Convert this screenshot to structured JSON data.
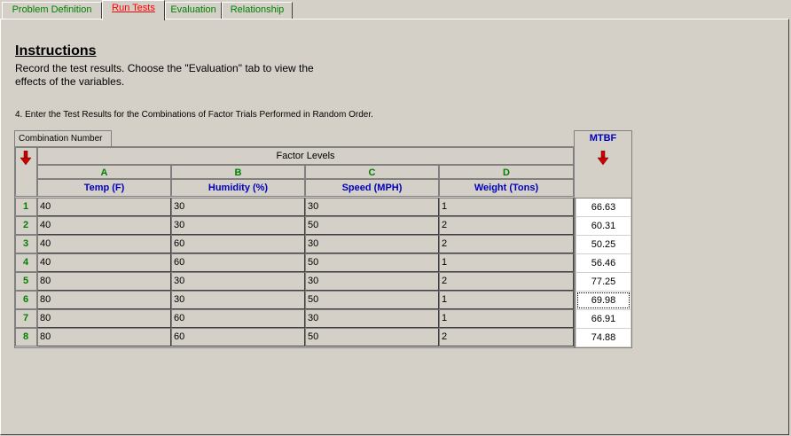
{
  "tabs": [
    {
      "label": "Problem Definition",
      "active": false
    },
    {
      "label": "Run Tests",
      "active": true
    },
    {
      "label": "Evaluation",
      "active": false
    },
    {
      "label": "Relationship",
      "active": false
    }
  ],
  "instructions": {
    "title": "Instructions",
    "text": "Record the test results. Choose the \"Evaluation\" tab to view the effects of the variables."
  },
  "step_text": "4. Enter the Test Results for the Combinations of Factor Trials Performed in Random Order.",
  "grid": {
    "combination_label": "Combination Number",
    "factor_levels_label": "Factor Levels",
    "mtbf_label": "MTBF",
    "factors": [
      {
        "letter": "A",
        "name": "Temp (F)"
      },
      {
        "letter": "B",
        "name": "Humidity (%)"
      },
      {
        "letter": "C",
        "name": "Speed (MPH)"
      },
      {
        "letter": "D",
        "name": "Weight (Tons)"
      }
    ],
    "rows": [
      {
        "n": "1",
        "a": "40",
        "b": "30",
        "c": "30",
        "d": "1",
        "mtbf": "66.63"
      },
      {
        "n": "2",
        "a": "40",
        "b": "30",
        "c": "50",
        "d": "2",
        "mtbf": "60.31"
      },
      {
        "n": "3",
        "a": "40",
        "b": "60",
        "c": "30",
        "d": "2",
        "mtbf": "50.25"
      },
      {
        "n": "4",
        "a": "40",
        "b": "60",
        "c": "50",
        "d": "1",
        "mtbf": "56.46"
      },
      {
        "n": "5",
        "a": "80",
        "b": "30",
        "c": "30",
        "d": "2",
        "mtbf": "77.25"
      },
      {
        "n": "6",
        "a": "80",
        "b": "30",
        "c": "50",
        "d": "1",
        "mtbf": "69.98"
      },
      {
        "n": "7",
        "a": "80",
        "b": "60",
        "c": "30",
        "d": "1",
        "mtbf": "66.91"
      },
      {
        "n": "8",
        "a": "80",
        "b": "60",
        "c": "50",
        "d": "2",
        "mtbf": "74.88"
      }
    ]
  },
  "colors": {
    "accent_green": "#008000",
    "header_blue": "#0000c0",
    "arrow_red": "#cc0000"
  },
  "icons": {
    "sort_arrow": "red-down-arrow-icon"
  }
}
